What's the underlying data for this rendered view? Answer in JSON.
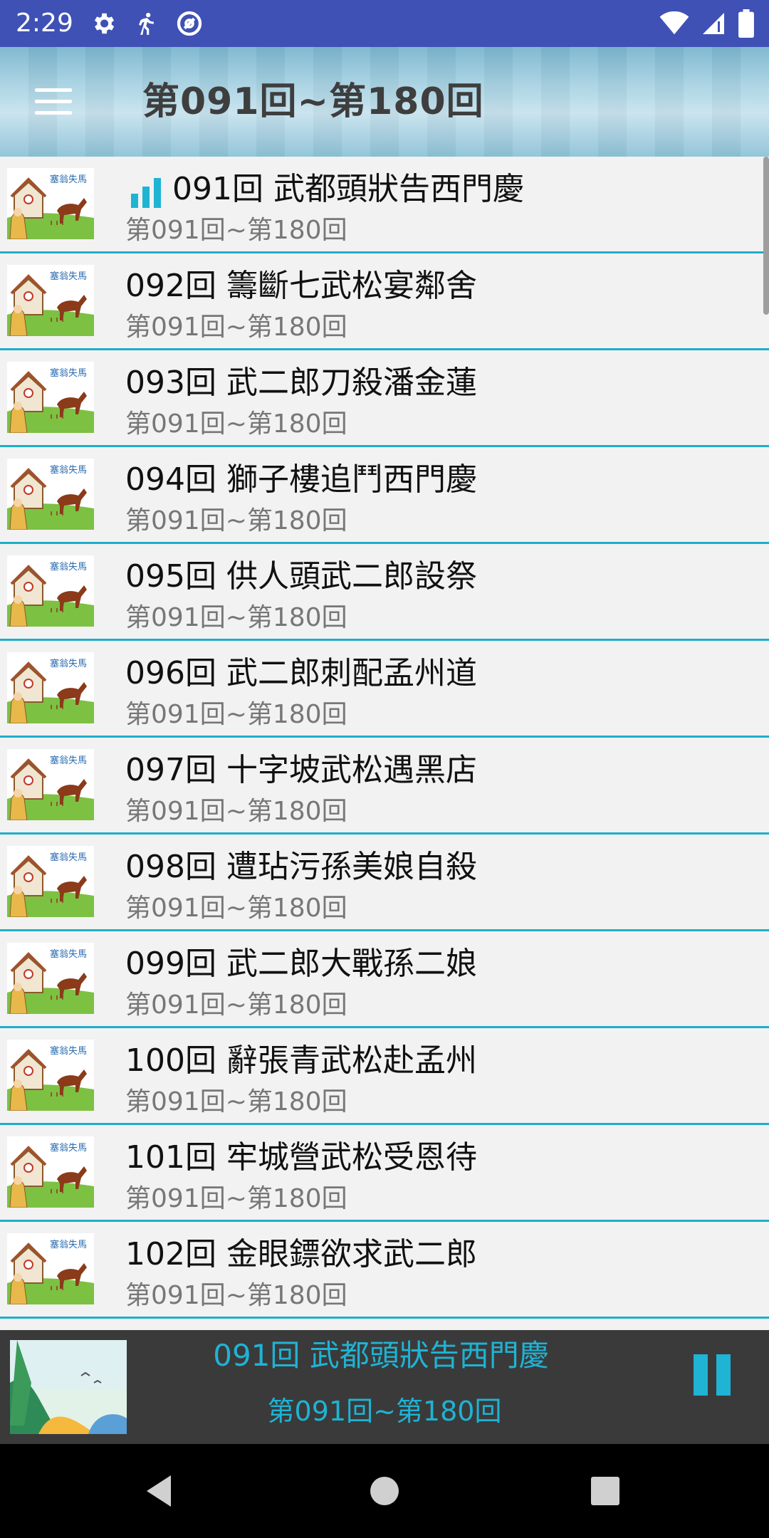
{
  "status_bar": {
    "time": "2:29",
    "left_icons": [
      "gear-icon",
      "runner-icon",
      "at-sync-icon"
    ],
    "right_icons": [
      "wifi-icon",
      "cell-signal-icon",
      "battery-icon"
    ]
  },
  "toolbar": {
    "menu_icon": "hamburger-menu-icon",
    "title": "第091回~第180回"
  },
  "list": {
    "items": [
      {
        "title": "091回 武都頭狀告西門慶",
        "subtitle": "第091回~第180回",
        "playing": true
      },
      {
        "title": "092回 籌斷七武松宴鄰舍",
        "subtitle": "第091回~第180回"
      },
      {
        "title": "093回 武二郎刀殺潘金蓮",
        "subtitle": "第091回~第180回"
      },
      {
        "title": "094回 獅子樓追鬥西門慶",
        "subtitle": "第091回~第180回"
      },
      {
        "title": "095回 供人頭武二郎設祭",
        "subtitle": "第091回~第180回"
      },
      {
        "title": "096回 武二郎刺配孟州道",
        "subtitle": "第091回~第180回"
      },
      {
        "title": "097回 十字坡武松遇黑店",
        "subtitle": "第091回~第180回"
      },
      {
        "title": "098回 遭玷污孫美娘自殺",
        "subtitle": "第091回~第180回"
      },
      {
        "title": "099回 武二郎大戰孫二娘",
        "subtitle": "第091回~第180回"
      },
      {
        "title": "100回 辭張青武松赴孟州",
        "subtitle": "第091回~第180回"
      },
      {
        "title": "101回 牢城營武松受恩待",
        "subtitle": "第091回~第180回"
      },
      {
        "title": "102回 金眼鏢欲求武二郎",
        "subtitle": "第091回~第180回"
      }
    ],
    "thumb_caption": "塞翁失馬"
  },
  "player": {
    "title": "091回 武都頭狀告西門慶",
    "subtitle": "第091回~第180回",
    "state": "playing",
    "accent": "#1fb3d4"
  },
  "nav_bar": {
    "buttons": [
      "back-icon",
      "home-icon",
      "recents-icon"
    ]
  }
}
